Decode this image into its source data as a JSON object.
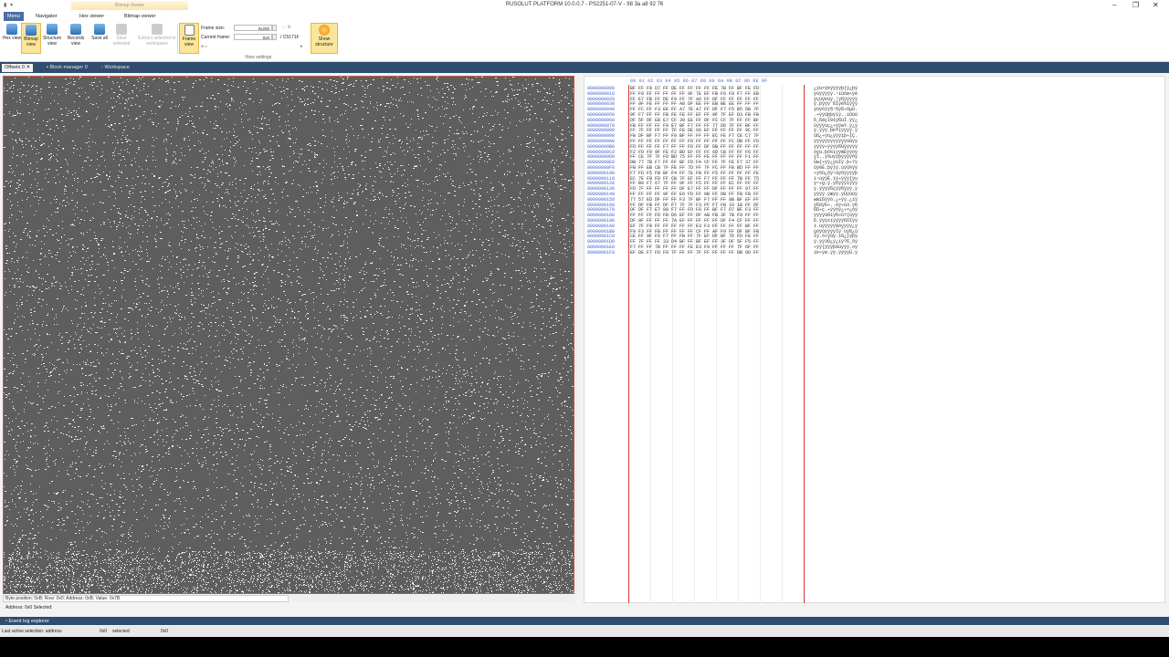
{
  "window": {
    "title": "RUSOLUT PLATFORM 10.0.0.7 - PS2251-07-V - 98 3a a8 92 76",
    "context_tab": "Bitmap Viewer"
  },
  "ribbon_tabs": [
    "Menu",
    "Navigator",
    "Hex viewer",
    "Bitmap viewer"
  ],
  "ribbon": {
    "hex_view": "Hex view",
    "bitmap_view": "Bitmap view",
    "structure_view": "Structure view",
    "records_view": "Records view",
    "save_all": "Save all",
    "save_selected": "Save selected",
    "extract_selected": "Extract selected to workspace",
    "frame_view": "Frame view",
    "show_structure": "Show structure",
    "frame_size_label": "Frame size:",
    "frame_size_value": "0x200",
    "current_frame_label": "Current frame:",
    "current_frame_value": "0x0",
    "frame_total": "/ C5171F",
    "group_label": "View settings"
  },
  "doc_tabs": [
    "Offsets 0",
    "Block manager 0",
    "Workspace"
  ],
  "bitmap": {
    "status": "Byte position: 0xB; Row: 0x0; Address: 0xB; Value: 0x7B",
    "selection": "Address: 0x0 Selected:"
  },
  "hex": {
    "header": "00 01 02 03 04 05 06 07 08 09 0A 0B 0C 0D 0E 0F",
    "offsets": [
      "0000000000",
      "0000000010",
      "0000000020",
      "0000000030",
      "0000000040",
      "0000000050",
      "0000000060",
      "0000000070",
      "0000000080",
      "0000000090",
      "00000000A0",
      "00000000B0",
      "00000000C0",
      "00000000D0",
      "00000000E0",
      "00000000F0",
      "0000000100",
      "0000000110",
      "0000000120",
      "0000000130",
      "0000000140",
      "0000000150",
      "0000000160",
      "0000000170",
      "0000000180",
      "0000000190",
      "00000001A0",
      "00000001B0",
      "00000001C0",
      "00000001D0",
      "00000001E0",
      "00000001F0"
    ],
    "rows": [
      "BF FF F9 D7 FF DE FF FF FF FF FE 7B FF BF FE FD",
      "FF F9 FF FF FF FF FF 9F 7E EF FB F6 F8 F7 FF EB",
      "FF E7 FB FF DE F9 FF 7F A6 FF DF FF FF FF FF FF",
      "FF 9F FE FF FF FF A8 DF EE FF EB BE EE FF FF FF",
      "FF FC FF F3 EE FF A7 7E A7 FF DF F7 F5 B5 DB 7F",
      "9F F7 FF FF FB FE FE FF EF FF 9F 7F EF D3 FB FB",
      "DF 5F DF EB E7 CF 39 EE FF DF FC CF 7F FF FF BF",
      "FB FF FF FF F9 E7 BF F7 FF FF 77 DD 7F FF BF FF",
      "FF 7F FF FF FF 7F FE DE 66 EF FF FF FF FF 9C FF",
      "FB DF BF F7 FF F9 BF FF FF FF EC FE F7 CE C7 7F",
      "FF FF FF FF FF FF FF FD FF FF FF FF FC DB FF FD",
      "FD FF FF FF F7 FF FF FD FF DF DB FF FF FF FF FF",
      "F2 FD F9 9F FE F2 BD EF FF FF 6D CB FF FF F6 FF",
      "FF CE 7F 7F FD BD 75 FF FF FE FF FF FF FF F1 FF",
      "DB 77 7B F7 FF FF BF FD FA CF FF 7F FE F7 37 FF",
      "FB FF EB CB 7F FE FF 7D FF 7F FC FF FB BD FF FF",
      "F7 FD F5 FB BF F4 FF 7E FB FF F5 FF FF FF FF FE",
      "EC 7E F9 FD FF CB 7F EF FF F7 FF FF FF 7B FF 75",
      "FF B9 F7 67 7F FF 9F FF F5 FF FF FF EC FF FF FF",
      "FD 7F FF FF FF FF DF E7 FF FF DF FF FF FF 97 FF",
      "FF FF FF FF 9F FF E6 FD FF 0B FF DB FF FB FB FF",
      "77 57 ED DF FF FF F3 7F BF F7 FF FF 8B BF EF FF",
      "FF DF FB FF DF F7 7F 7F F3 FF F7 FB 33 1B FF DF",
      "DF DF F7 E7 88 F7 FF FD F6 FF BF F7 D7 BF F3 FF",
      "FF FF FF FD FB D6 EF FF DF AB FB 3F 7B F9 FF FF",
      "DF 9F FF FF FF 7A EF FF FF FF FF DF F4 CF FF FF",
      "EF 7F F9 FF FF FF FF FF E3 F3 FF FF FF FF BF FF",
      "F9 F3 FF FB FF FF FF FF CF FF AF F9 FF DF BF FB",
      "CE FF 9F F6 F7 FF FB FF 7F EF DF BF 7D FD FE FF",
      "FF 7F FF FF 33 D4 BF FF BF EF FF 3F DF 5F F5 FF",
      "F7 FF FF 7B FF FF FF FE E3 F9 FF FF FF 7F 6F FF",
      "EF DE F7 FD F8 7F FF FF 7F FF FF FF FF DB 9D FF"
    ],
    "ascii": [
      "¿ÿù×ÿÞÿÿÿÿþ{ÿ¿þý",
      "ÿùÿÿÿÿÿ.~ïûöø÷ÿë",
      "ÿçûÿÞùÿ.¦ÿßÿÿÿÿÿ",
      "ÿ.þÿÿÿ¨ßîÿë¾îÿÿÿ",
      "ÿüÿóîÿ§~§ÿß÷õµÛ.",
      ".÷ÿÿûþþÿïÿ..ïÓûû",
      "ß_ßëçÏ9îÿßüÏ.ÿÿ¿",
      "ûÿÿÿùç¿÷ÿÿwÝ.ÿ¿ÿ",
      "ÿ.ÿÿÿ.þÞfïÿÿÿÿ.ÿ",
      "ûß¿÷ÿù¿ÿÿÿìþ÷ÎÇ.",
      "ÿÿÿÿÿÿÿýÿÿÿÿüÛÿý",
      "ýÿÿÿ÷ÿÿýÿßÛÿÿÿÿÿ",
      "òýù.þò½ïÿÿmËÿÿöÿ",
      "ÿÎ..ý½uÿÿþÿÿÿÿñÿ",
      "Ûw{÷ÿÿ¿ýúÏÿ.þ÷7ÿ",
      "ûÿëË.þÿ}ÿ.üÿû½ÿÿ",
      "÷ýõû¿ôÿ~ûÿõÿÿÿÿþ",
      "ì~ùýÿË.ïÿ÷ÿÿÿ{ÿu",
      "ÿ¹÷g.ÿ.ÿõÿÿÿìÿÿÿ",
      "ý.ÿÿÿÿßçÿÿßÿÿÿ.ÿ",
      "ÿÿÿÿ.ÿæýÿ.ÿÛÿûûÿ",
      "wWíßÿÿó.¿÷ÿÿ.¿ïÿ",
      "ÿßûÿß÷..óÿ÷û3.ÿß",
      "ßß÷ç.÷ÿýöÿ¿÷×¿óÿ",
      "ÿÿÿýûÖïÿß«û?{ùÿÿ",
      "ß.ÿÿÿzïÿÿÿÿßôÏÿÿ",
      "ï.ùÿÿÿÿÿãóÿÿÿÿ¿ÿ",
      "ùóÿûÿÿÿÿÏÿ¯ùÿß¿û",
      "Îÿ.ö÷ÿûÿ.ïß¿}ýþÿ",
      "ÿ.ÿÿ3Ô¿ÿ¿ïÿ?ß_õÿ",
      "÷ÿÿ{ÿÿÿþãùÿÿÿ.oÿ",
      "ïÞ÷ýø.ÿÿ.ÿÿÿÿÛ.ÿ"
    ]
  },
  "bottom_tab": "Event log explorer",
  "statusbar": {
    "last_active": "Last active selection: address",
    "addr": "0x0",
    "selected_label": "selected",
    "selected_value": "0x0"
  },
  "colors": {
    "accent": "#2f4d6e",
    "bitmap_bg": "#5e5e5e",
    "highlight": "#fbe59a",
    "hex_offset": "#3d5fd0",
    "hex_border": "#d33333"
  }
}
